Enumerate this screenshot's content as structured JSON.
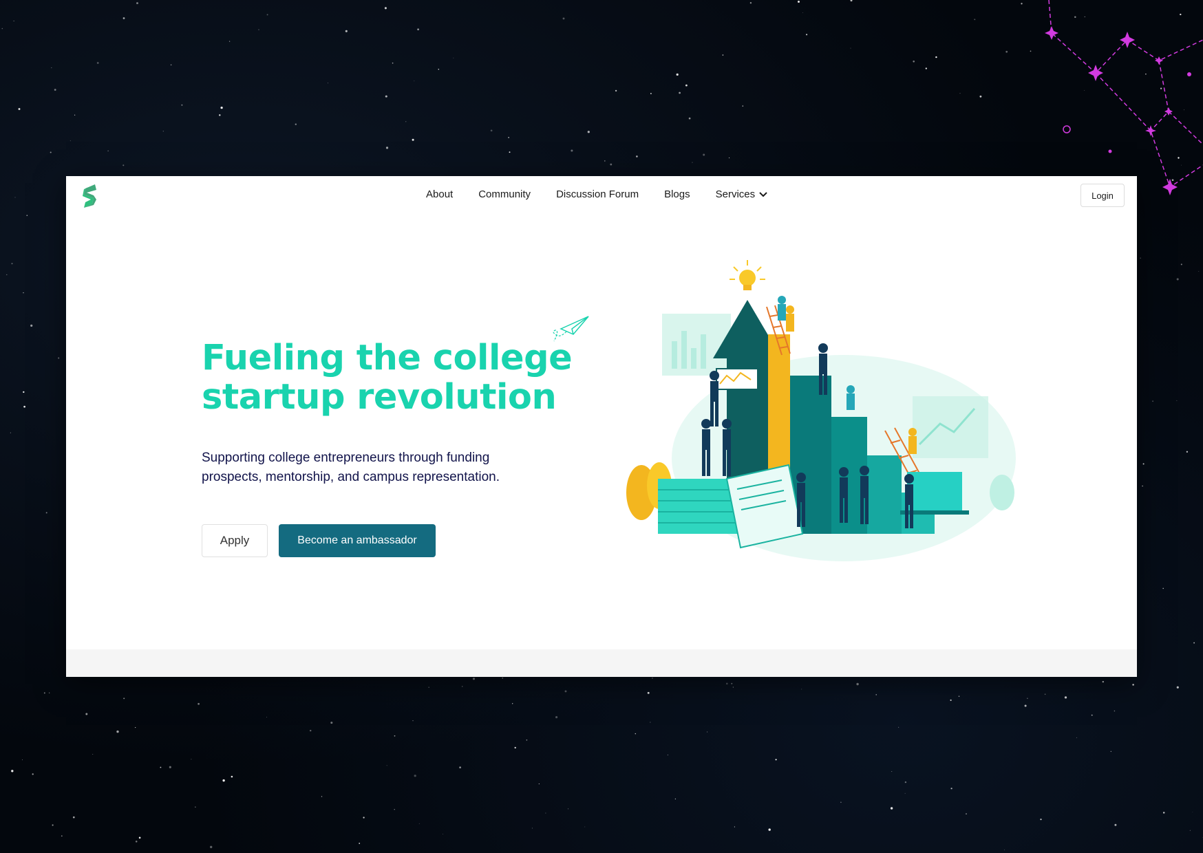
{
  "nav": {
    "logo_icon": "s-logo-icon",
    "links": [
      {
        "label": "About"
      },
      {
        "label": "Community"
      },
      {
        "label": "Discussion Forum"
      },
      {
        "label": "Blogs"
      },
      {
        "label": "Services"
      }
    ],
    "services_icon": "chevron-down-icon",
    "login_label": "Login"
  },
  "hero": {
    "title_line1": "Fueling the college",
    "title_line2": "startup revolution",
    "subtitle": "Supporting college entrepreneurs through funding prospects, mentorship, and campus representation.",
    "apply_label": "Apply",
    "ambassador_label": "Become an ambassador",
    "plane_icon": "paper-plane-icon",
    "illustration": "growth-staircase-illustration"
  },
  "colors": {
    "accent": "#19d3ae",
    "primary_button": "#146b80",
    "heading_text": "#11134a",
    "constellation": "#d23be0"
  }
}
